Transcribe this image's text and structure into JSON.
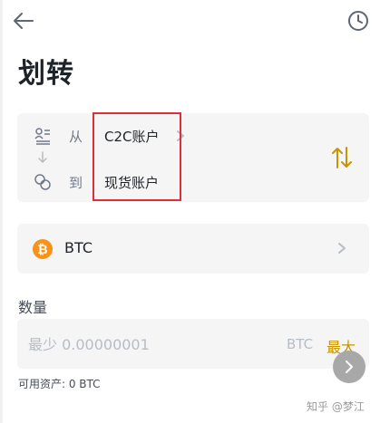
{
  "header": {
    "back_icon": "arrow-left-icon",
    "history_icon": "clock-history-icon"
  },
  "page": {
    "title": "划转"
  },
  "transfer": {
    "from_prefix": "从",
    "from_account": "C2C账户",
    "to_prefix": "到",
    "to_account": "现货账户",
    "from_icon": "account-icon",
    "to_icon": "exchange-icon",
    "swap_icon": "swap-icon"
  },
  "coin": {
    "symbol": "BTC",
    "icon_glyph": "₿",
    "icon_color": "#f7931a"
  },
  "amount": {
    "label": "数量",
    "placeholder": "最少 0.00000001",
    "unit": "BTC",
    "max_label": "最大"
  },
  "available": {
    "text": "可用资产: 0 BTC"
  },
  "watermark": {
    "text": "知乎 @梦江"
  },
  "colors": {
    "accent": "#c99400",
    "highlight": "#d9303a",
    "card_bg": "#f5f5f5"
  }
}
